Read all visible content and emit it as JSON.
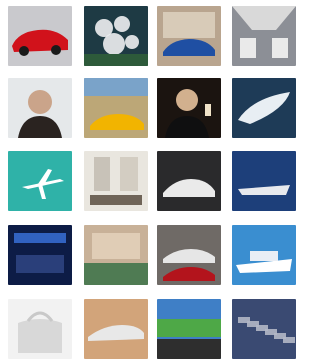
{
  "gallery": {
    "tiles": [
      {
        "row": 0,
        "col": 0,
        "subject": "red-sports-car",
        "bg": "#c9c9cd",
        "accent": "#d1121b"
      },
      {
        "row": 0,
        "col": 1,
        "subject": "white-flowers",
        "bg": "#1e3a44",
        "accent": "#eef0f2"
      },
      {
        "row": 0,
        "col": 2,
        "subject": "blue-supercar-mansion",
        "bg": "#b9a58f",
        "accent": "#1f4fa3"
      },
      {
        "row": 0,
        "col": 3,
        "subject": "jet-cabin",
        "bg": "#8c8f96",
        "accent": "#eaeaea"
      },
      {
        "row": 1,
        "col": 0,
        "subject": "man-portrait",
        "bg": "#e5e8ea",
        "accent": "#2a2320"
      },
      {
        "row": 1,
        "col": 1,
        "subject": "cars-desert",
        "bg": "#bca777",
        "accent": "#f2b400"
      },
      {
        "row": 1,
        "col": 2,
        "subject": "man-toast",
        "bg": "#1b1410",
        "accent": "#f0e3c8"
      },
      {
        "row": 1,
        "col": 3,
        "subject": "yacht-aerial",
        "bg": "#1e3b57",
        "accent": "#e8eef3"
      },
      {
        "row": 2,
        "col": 0,
        "subject": "plane-over-turquoise",
        "bg": "#2fb2a8",
        "accent": "#ffffff"
      },
      {
        "row": 2,
        "col": 1,
        "subject": "luxury-interior",
        "bg": "#e9e6df",
        "accent": "#6f6458"
      },
      {
        "row": 2,
        "col": 2,
        "subject": "white-supercar-night",
        "bg": "#2a2a2c",
        "accent": "#eaeaea"
      },
      {
        "row": 2,
        "col": 3,
        "subject": "yacht-blue-sea",
        "bg": "#1d3f7a",
        "accent": "#e7e9ee"
      },
      {
        "row": 3,
        "col": 0,
        "subject": "blue-lit-limo-interior",
        "bg": "#0d1c46",
        "accent": "#3b74e0"
      },
      {
        "row": 3,
        "col": 1,
        "subject": "villa-pool",
        "bg": "#c8b198",
        "accent": "#4f7b53"
      },
      {
        "row": 3,
        "col": 2,
        "subject": "supercars-garage",
        "bg": "#6f6a66",
        "accent": "#b3141c"
      },
      {
        "row": 3,
        "col": 3,
        "subject": "superyacht",
        "bg": "#3a8ed0",
        "accent": "#ffffff"
      },
      {
        "row": 4,
        "col": 0,
        "subject": "white-leather-bag",
        "bg": "#f2f2f2",
        "accent": "#d8d8d8"
      },
      {
        "row": 4,
        "col": 1,
        "subject": "race-car-track",
        "bg": "#d2a47a",
        "accent": "#e8e8e8"
      },
      {
        "row": 4,
        "col": 2,
        "subject": "stadium-crowd",
        "bg": "#3f7fc6",
        "accent": "#4ea847"
      },
      {
        "row": 4,
        "col": 3,
        "subject": "marina-boats",
        "bg": "#3a4a72",
        "accent": "#b2b7c5"
      }
    ]
  }
}
